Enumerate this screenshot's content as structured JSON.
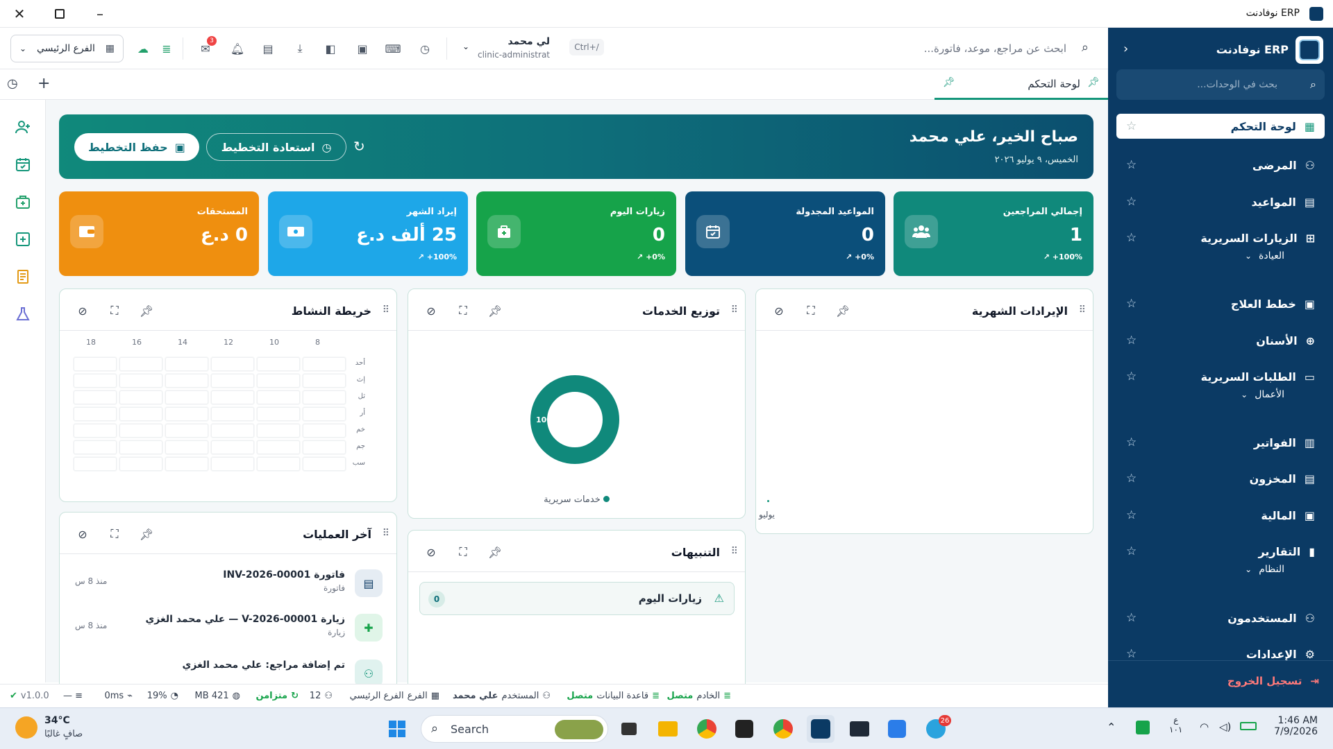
{
  "window": {
    "title": "نوفادنت ERP"
  },
  "sidebar": {
    "brand": "نوفادنت ERP",
    "search_placeholder": "بحث في الوحدات...",
    "items": [
      {
        "label": "لوحة التحكم",
        "icon": "dashboard-icon"
      },
      {
        "label": "المرضى",
        "icon": "users-icon"
      },
      {
        "label": "المواعيد",
        "icon": "calendar-icon"
      },
      {
        "label": "الزيارات السريرية",
        "icon": "plus-square-icon"
      }
    ],
    "group_clinic": "العيادة",
    "clinic_items": [
      {
        "label": "خطط العلاج",
        "icon": "clipboard-icon"
      },
      {
        "label": "الأسنان",
        "icon": "tooth-icon"
      },
      {
        "label": "الطلبات السريرية",
        "icon": "folder-icon"
      }
    ],
    "group_business": "الأعمال",
    "business_items": [
      {
        "label": "الفواتير",
        "icon": "receipt-icon"
      },
      {
        "label": "المخزون",
        "icon": "archive-icon"
      },
      {
        "label": "المالية",
        "icon": "wallet-icon"
      },
      {
        "label": "التقارير",
        "icon": "bar-chart-icon"
      }
    ],
    "group_system": "النظام",
    "system_items": [
      {
        "label": "المستخدمون",
        "icon": "user-cog-icon"
      },
      {
        "label": "الإعدادات",
        "icon": "gear-icon"
      }
    ],
    "logout": "تسجيل الخروج"
  },
  "toolbar": {
    "search_placeholder": "ابحث عن مراجع، موعد، فاتورة...",
    "shortcut": "Ctrl+/",
    "user_name": "لي محمد",
    "user_role": "clinic-administrat",
    "branch": "الفرع الرئيسي",
    "mail_badge": "3"
  },
  "tabs": [
    {
      "label": "لوحة التحكم"
    }
  ],
  "hero": {
    "greeting": "صباح الخير، علي محمد",
    "date": "الخميس، ٩ يوليو ٢٠٢٦",
    "restore_label": "استعادة التخطيط",
    "save_label": "حفظ التخطيط"
  },
  "kpis": [
    {
      "title": "إجمالي المراجعين",
      "value": "1",
      "delta": "+100%",
      "color": "#10897b"
    },
    {
      "title": "المواعيد المجدولة",
      "value": "0",
      "delta": "+0%",
      "color": "#0b4f7a"
    },
    {
      "title": "زيارات اليوم",
      "value": "0",
      "delta": "+0%",
      "color": "#16a34a"
    },
    {
      "title": "إيراد الشهر",
      "value": "25 ألف د.ع",
      "delta": "+100%",
      "color": "#1ea7e8"
    },
    {
      "title": "المستحقات",
      "value": "0 د.ع",
      "delta": "",
      "color": "#ef8f0f"
    }
  ],
  "panels": {
    "monthly_revenue": {
      "title": "الإيرادات الشهرية",
      "x_label": "يوليو"
    },
    "services": {
      "title": "توزيع الخدمات",
      "legend": "خدمات سريرية",
      "pct": "100%"
    },
    "heatmap": {
      "title": "خريطة النشاط",
      "hours": [
        "18",
        "16",
        "14",
        "12",
        "10",
        "8"
      ],
      "days": [
        "أحد",
        "إث",
        "ثل",
        "أر",
        "خم",
        "جم",
        "سب"
      ]
    },
    "alerts": {
      "title": "التنبيهات",
      "item": "زيارات اليوم",
      "count": "0"
    },
    "recent": {
      "title": "آخر العمليات",
      "items": [
        {
          "title": "فاتورة INV-2026-00001",
          "sub": "فاتورة",
          "time": "منذ 8 س"
        },
        {
          "title": "زيارة V-2026-00001 — علي محمد الغزي",
          "sub": "زيارة",
          "time": "منذ 8 س"
        },
        {
          "title": "تم إضافة مراجع: علي محمد الغزي",
          "sub": "",
          "time": ""
        }
      ]
    }
  },
  "chart_data": {
    "type": "pie",
    "categories": [
      "خدمات سريرية"
    ],
    "values": [
      100
    ]
  },
  "statusbar": {
    "server_label": "الخادم",
    "server_state": "متصل",
    "db_label": "قاعدة البيانات",
    "db_state": "متصل",
    "user_label": "المستخدم",
    "user_value": "علي محمد",
    "branch_label": "الفرع",
    "branch_value": "الفرع الرئيسي",
    "count": "12",
    "sync": "متزامن",
    "memory": "421 MB",
    "cpu": "19%",
    "latency": "0ms",
    "version": "v1.0.0"
  },
  "taskbar": {
    "temp": "34°C",
    "weather": "صافٍ غالبًا",
    "search": "Search",
    "lang1": "ع",
    "lang2": "١٠١",
    "time": "1:46 AM",
    "date": "7/9/2026",
    "badge": "26"
  }
}
